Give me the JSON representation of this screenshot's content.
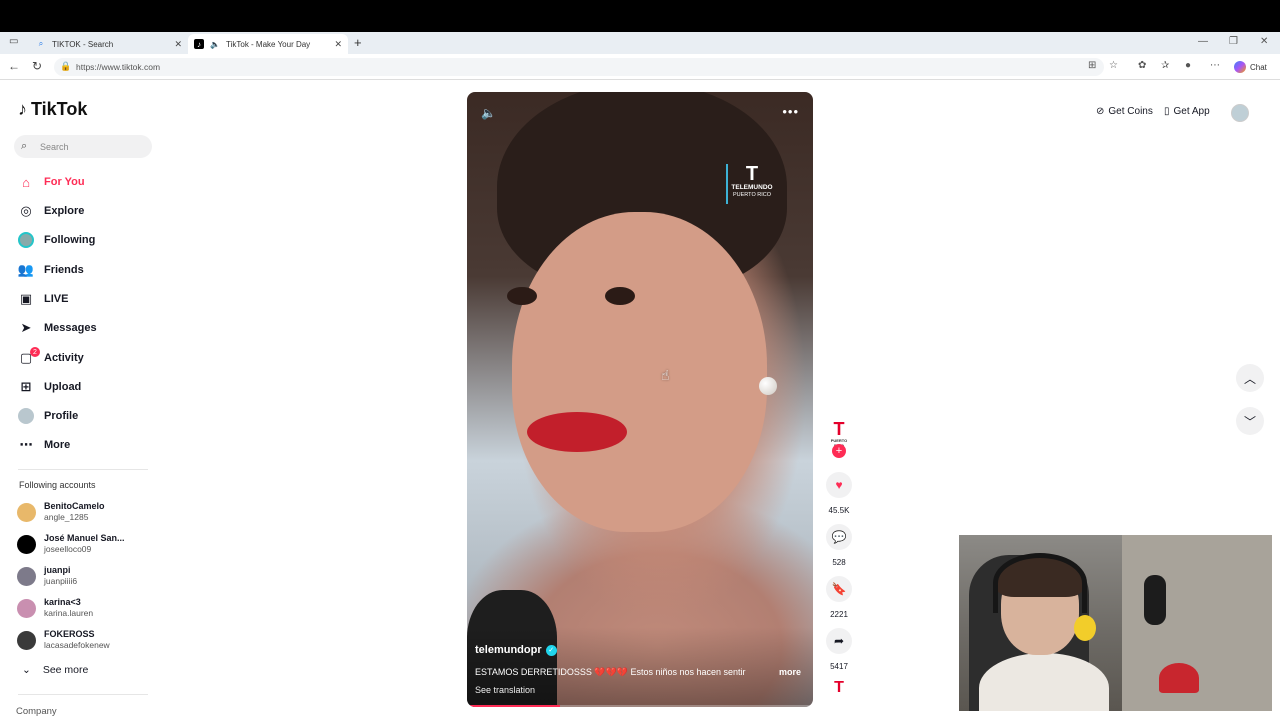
{
  "browser": {
    "tabs": [
      {
        "label": "TIKTOK - Search"
      },
      {
        "label": "TikTok - Make Your Day"
      }
    ],
    "url": "https://www.tiktok.com",
    "chat_label": "Chat"
  },
  "sidebar": {
    "logo": "TikTok",
    "search_placeholder": "Search",
    "menu": [
      {
        "label": "For You",
        "icon": "home-icon"
      },
      {
        "label": "Explore",
        "icon": "compass-icon"
      },
      {
        "label": "Following",
        "icon": "following-avatar"
      },
      {
        "label": "Friends",
        "icon": "friends-icon"
      },
      {
        "label": "LIVE",
        "icon": "live-icon"
      },
      {
        "label": "Messages",
        "icon": "send-icon"
      },
      {
        "label": "Activity",
        "icon": "activity-icon"
      },
      {
        "label": "Upload",
        "icon": "upload-icon"
      },
      {
        "label": "Profile",
        "icon": "profile-avatar"
      },
      {
        "label": "More",
        "icon": "more-dots-icon"
      }
    ],
    "activity_badge": "2",
    "following_title": "Following accounts",
    "accounts": [
      {
        "name": "BenitoCamelo",
        "handle": "angle_1285",
        "color": "#e8b86a"
      },
      {
        "name": "José Manuel San...",
        "handle": "joseelloco09",
        "color": "#000000"
      },
      {
        "name": "juanpi",
        "handle": "juanpiiii6",
        "color": "#7d7a8a"
      },
      {
        "name": "karina<3",
        "handle": "karina.lauren",
        "color": "#c98fb0"
      },
      {
        "name": "FOKEROSS",
        "handle": "lacasadefokenew",
        "color": "#3a3a3a"
      }
    ],
    "see_more": "See more",
    "company": "Company"
  },
  "video": {
    "watermark_letter": "T",
    "watermark_line1": "TELEMUNDO",
    "watermark_line2": "PUERTO RICO",
    "username": "telemundopr",
    "caption": "ESTAMOS DERRETIDOSSS 💔💔💔 Estos niños nos hacen sentir",
    "more": "more",
    "see_translation": "See translation",
    "progress": 0.27
  },
  "actions": {
    "creator_letter": "T",
    "creator_sub": "PUERTO RICO",
    "likes": "45.5K",
    "comments": "528",
    "saves": "2221",
    "shares": "5417",
    "music_letter": "T"
  },
  "header_right": {
    "get_coins": "Get Coins",
    "get_app": "Get App"
  }
}
